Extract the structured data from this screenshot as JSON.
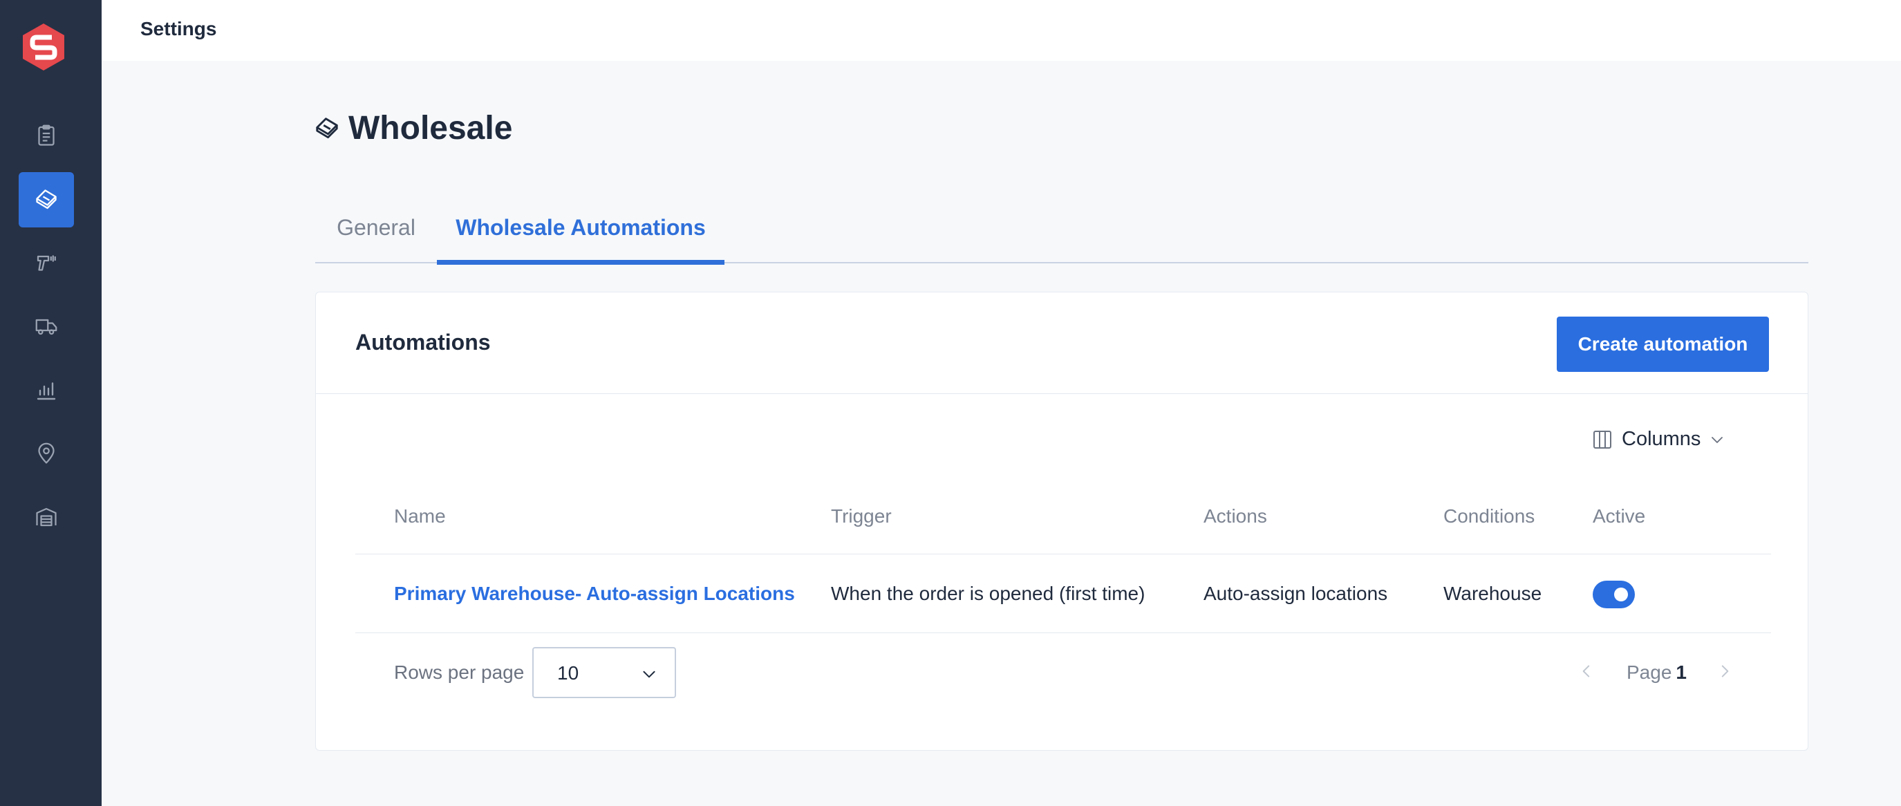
{
  "app": {
    "header_title": "Settings",
    "accent_color": "#2f6fd9",
    "sidebar_color": "#263145",
    "logo_color": "#e5484d"
  },
  "sidebar": {
    "items": [
      {
        "icon": "clipboard-icon",
        "active": false
      },
      {
        "icon": "tags-icon",
        "active": true
      },
      {
        "icon": "scanner-icon",
        "active": false
      },
      {
        "icon": "truck-icon",
        "active": false
      },
      {
        "icon": "bar-chart-icon",
        "active": false
      },
      {
        "icon": "location-pin-icon",
        "active": false
      },
      {
        "icon": "warehouse-icon",
        "active": false
      }
    ]
  },
  "page": {
    "title": "Wholesale",
    "title_icon": "tags-icon",
    "tabs": [
      {
        "label": "General",
        "active": false
      },
      {
        "label": "Wholesale Automations",
        "active": true
      }
    ]
  },
  "automations": {
    "title": "Automations",
    "create_button": "Create automation",
    "columns_button": "Columns",
    "table": {
      "headers": [
        "Name",
        "Trigger",
        "Actions",
        "Conditions",
        "Active"
      ],
      "rows": [
        {
          "name": "Primary Warehouse- Auto-assign Locations",
          "trigger": "When the order is opened (first time)",
          "actions": "Auto-assign locations",
          "conditions": "Warehouse",
          "active": true
        }
      ]
    },
    "pagination": {
      "rows_per_page_label": "Rows per page",
      "rows_per_page_value": "10",
      "page_label": "Page",
      "page_number": "1"
    }
  }
}
